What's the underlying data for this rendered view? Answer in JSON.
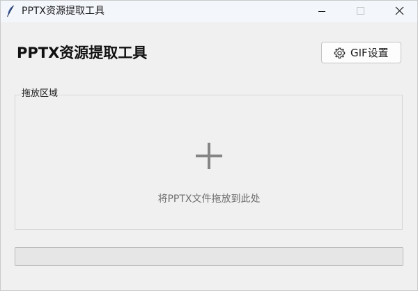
{
  "window": {
    "title": "PPTX资源提取工具",
    "controls": [
      "minimize",
      "maximize",
      "close"
    ]
  },
  "header": {
    "title": "PPTX资源提取工具",
    "gif_button_label": "GIF设置"
  },
  "drop_zone": {
    "legend": "拖放区域",
    "hint": "将PPTX文件拖放到此处"
  },
  "progress": {
    "value": 0
  },
  "icons": {
    "app": "feather-icon",
    "gif_button": "gear-icon",
    "drop": "plus-icon"
  },
  "colors": {
    "window_bg": "#f0f0f0",
    "titlebar_bg": "#f3f6fb",
    "drop_hint": "#6e6e6e",
    "plus_icon": "#858585"
  }
}
